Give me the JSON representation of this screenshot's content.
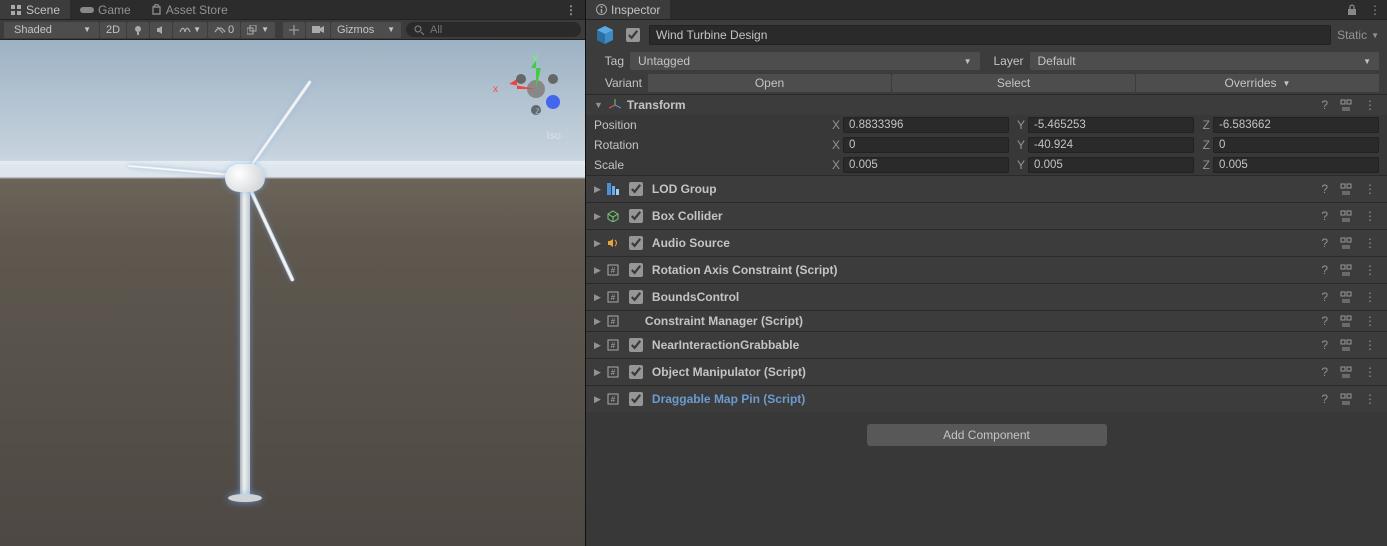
{
  "scene": {
    "tabs": [
      {
        "label": "Scene",
        "active": true
      },
      {
        "label": "Game",
        "active": false
      },
      {
        "label": "Asset Store",
        "active": false
      }
    ],
    "toolbar": {
      "shading": "Shaded",
      "btn_2d": "2D",
      "hidden_count": "0",
      "gizmos_label": "Gizmos",
      "search_placeholder": "All"
    },
    "viewport": {
      "axis_x": "x",
      "axis_y": "y",
      "axis_z": "z",
      "perspective": "Iso"
    }
  },
  "inspector": {
    "tab": "Inspector",
    "object": {
      "enabled": true,
      "name": "Wind Turbine Design",
      "static_label": "Static",
      "tag_label": "Tag",
      "tag_value": "Untagged",
      "layer_label": "Layer",
      "layer_value": "Default",
      "variant_label": "Variant",
      "open_btn": "Open",
      "select_btn": "Select",
      "overrides_btn": "Overrides"
    },
    "transform": {
      "title": "Transform",
      "position_label": "Position",
      "position": {
        "x": "0.8833396",
        "y": "-5.465253",
        "z": "-6.583662"
      },
      "rotation_label": "Rotation",
      "rotation": {
        "x": "0",
        "y": "-40.924",
        "z": "0"
      },
      "scale_label": "Scale",
      "scale": {
        "x": "0.005",
        "y": "0.005",
        "z": "0.005"
      }
    },
    "components": [
      {
        "title": "LOD Group",
        "icon": "lod",
        "enabled": true
      },
      {
        "title": "Box Collider",
        "icon": "box",
        "enabled": true
      },
      {
        "title": "Audio Source",
        "icon": "audio",
        "enabled": true
      },
      {
        "title": "Rotation Axis Constraint (Script)",
        "icon": "script",
        "enabled": true
      },
      {
        "title": "BoundsControl",
        "icon": "script",
        "enabled": true
      },
      {
        "title": "Constraint Manager (Script)",
        "icon": "script",
        "enabled": null
      },
      {
        "title": "NearInteractionGrabbable",
        "icon": "script",
        "enabled": true
      },
      {
        "title": "Object Manipulator (Script)",
        "icon": "script",
        "enabled": true
      },
      {
        "title": "Draggable Map Pin (Script)",
        "icon": "script",
        "enabled": true,
        "link": true
      }
    ],
    "add_component": "Add Component"
  }
}
